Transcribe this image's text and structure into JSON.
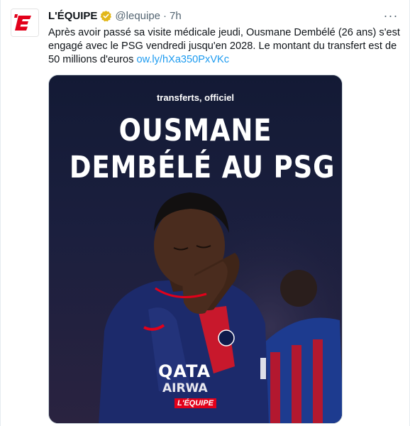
{
  "account": {
    "name": "L'ÉQUIPE",
    "handle": "@lequipe",
    "separator": "·",
    "time": "7h",
    "avatar_letter": "'E",
    "brand_color": "#e2001a",
    "verified_color": "#e2b719"
  },
  "tweet": {
    "text": "Après avoir passé sa visite médicale jeudi, Ousmane Dembélé (26 ans) s'est engagé avec le PSG vendredi jusqu'en 2028. Le montant du transfert est de 50 millions d'euros ",
    "link": "ow.ly/hXa350PxVKc",
    "link_color": "#1d9bf0"
  },
  "menu": {
    "more_label": "···",
    "icon": "more-icon"
  },
  "media": {
    "kicker": "transferts, officiel",
    "headline_line1": "OUSMANE",
    "headline_line2": "DEMBÉLÉ AU PSG",
    "sponsor_line1": "QATA",
    "sponsor_line2": "AIRWA",
    "watermark": "L'ÉQUIPE",
    "jersey_color": "#1c2a6b",
    "background_color": "#171b3a"
  }
}
